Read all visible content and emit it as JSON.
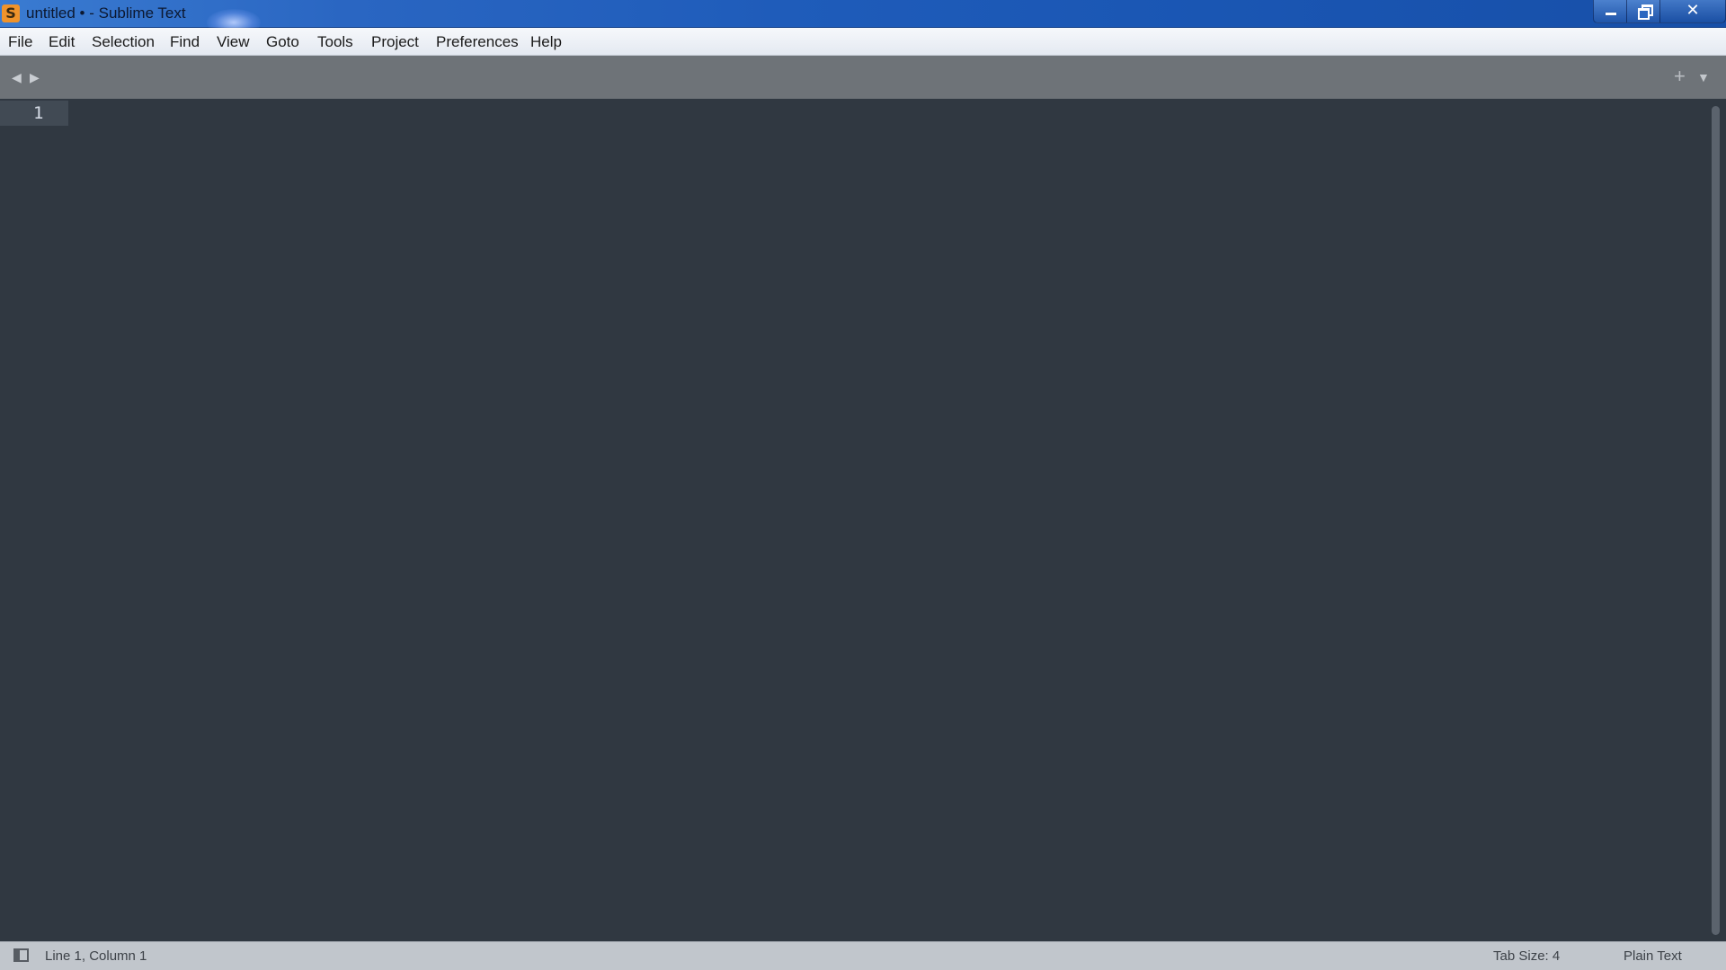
{
  "window": {
    "title": "untitled • - Sublime Text",
    "app_icon_letter": "S",
    "accent_color": "#f0932b",
    "controls": {
      "minimize_icon": "minimize-icon",
      "restore_icon": "restore-icon",
      "close_icon": "close-icon",
      "close_glyph": "✕"
    }
  },
  "menu": {
    "items": [
      "File",
      "Edit",
      "Selection",
      "Find",
      "View",
      "Goto",
      "Tools",
      "Project",
      "Preferences",
      "Help"
    ]
  },
  "tabbar": {
    "nav_left_glyph": "◀",
    "nav_right_glyph": "▶",
    "new_tab_glyph": "+",
    "dropdown_glyph": "▼"
  },
  "editor": {
    "line_numbers": [
      "1"
    ],
    "background_color": "#303841"
  },
  "statusbar": {
    "cursor_position": "Line 1, Column 1",
    "tab_size": "Tab Size: 4",
    "syntax": "Plain Text"
  }
}
